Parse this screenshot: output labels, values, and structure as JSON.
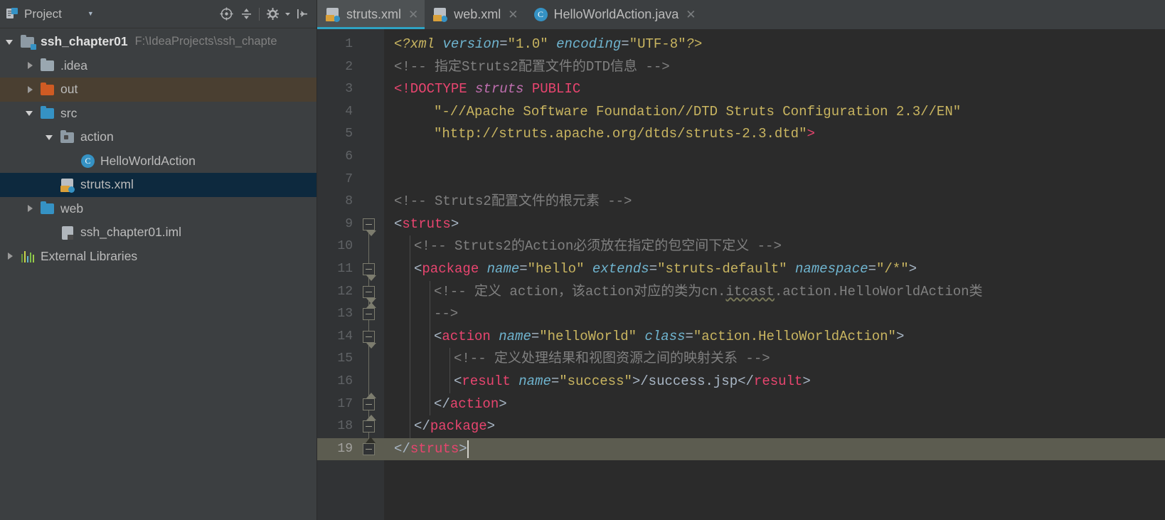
{
  "sidebar": {
    "header": {
      "title": "Project",
      "dropdown_icon": "chevron-down-icon",
      "icons": [
        "locate-icon",
        "collapse-all-icon",
        "settings-icon",
        "hide-icon"
      ]
    },
    "tree": [
      {
        "label": "ssh_chapter01",
        "path": "F:\\IdeaProjects\\ssh_chapte",
        "icon": "module-folder-icon",
        "depth": 0,
        "arrow": "down",
        "bold": true,
        "state": "normal"
      },
      {
        "label": ".idea",
        "path": "",
        "icon": "folder-gray-icon",
        "depth": 1,
        "arrow": "right",
        "bold": false,
        "state": "normal"
      },
      {
        "label": "out",
        "path": "",
        "icon": "folder-orange-icon",
        "depth": 1,
        "arrow": "right",
        "bold": false,
        "state": "brown"
      },
      {
        "label": "src",
        "path": "",
        "icon": "folder-blue-icon",
        "depth": 1,
        "arrow": "down",
        "bold": false,
        "state": "normal"
      },
      {
        "label": "action",
        "path": "",
        "icon": "package-folder-icon",
        "depth": 2,
        "arrow": "down",
        "bold": false,
        "state": "normal"
      },
      {
        "label": "HelloWorldAction",
        "path": "",
        "icon": "java-class-icon",
        "depth": 3,
        "arrow": "none",
        "bold": false,
        "state": "normal"
      },
      {
        "label": "struts.xml",
        "path": "",
        "icon": "xml-file-icon",
        "depth": 2,
        "arrow": "none",
        "bold": false,
        "state": "selected"
      },
      {
        "label": "web",
        "path": "",
        "icon": "folder-blue-icon",
        "depth": 1,
        "arrow": "right",
        "bold": false,
        "state": "normal"
      },
      {
        "label": "ssh_chapter01.iml",
        "path": "",
        "icon": "iml-file-icon",
        "depth": 2,
        "arrow": "none",
        "bold": false,
        "state": "normal"
      },
      {
        "label": "External Libraries",
        "path": "",
        "icon": "libraries-icon",
        "depth": 0,
        "arrow": "right",
        "bold": false,
        "state": "normal"
      }
    ]
  },
  "editor": {
    "tabs": [
      {
        "label": "struts.xml",
        "icon": "xml-file-icon",
        "active": true,
        "closable": true
      },
      {
        "label": "web.xml",
        "icon": "xml-file-icon",
        "active": false,
        "closable": true
      },
      {
        "label": "HelloWorldAction.java",
        "icon": "java-class-icon",
        "active": false,
        "closable": true
      }
    ],
    "current_line": 19,
    "line_numbers": [
      1,
      2,
      3,
      4,
      5,
      6,
      7,
      8,
      9,
      10,
      11,
      12,
      13,
      14,
      15,
      16,
      17,
      18,
      19
    ],
    "colors": {
      "background": "#2b2b2b",
      "gutter": "#313335",
      "current_line": "#5c5c50",
      "tag": "#e8456f",
      "attribute": "#6fb4cf",
      "value": "#c9b560",
      "comment": "#808080",
      "text": "#a9b7c6",
      "tab_underline": "#2ea3c4",
      "selection": "#0d293e"
    },
    "lines": [
      {
        "n": 1,
        "indent": 0,
        "tokens": [
          {
            "t": "proc",
            "v": "<?xml "
          },
          {
            "t": "attr",
            "v": "version"
          },
          {
            "t": "eq",
            "v": "="
          },
          {
            "t": "val",
            "v": "\"1.0\""
          },
          {
            "t": "val",
            "v": " "
          },
          {
            "t": "attr",
            "v": "encoding"
          },
          {
            "t": "eq",
            "v": "="
          },
          {
            "t": "val",
            "v": "\"UTF-8\""
          },
          {
            "t": "proc",
            "v": "?>"
          }
        ]
      },
      {
        "n": 2,
        "indent": 0,
        "tokens": [
          {
            "t": "cmt",
            "v": "<!-- 指定Struts2配置文件的DTD信息 -->"
          }
        ]
      },
      {
        "n": 3,
        "indent": 0,
        "tokens": [
          {
            "t": "doctype",
            "v": "<!DOCTYPE "
          },
          {
            "t": "dtname",
            "v": "struts"
          },
          {
            "t": "doctype",
            "v": " PUBLIC"
          }
        ]
      },
      {
        "n": 4,
        "indent": 2,
        "tokens": [
          {
            "t": "val",
            "v": "\"-//Apache Software Foundation//DTD Struts Configuration 2.3//EN\""
          }
        ]
      },
      {
        "n": 5,
        "indent": 2,
        "tokens": [
          {
            "t": "val",
            "v": "\"http://struts.apache.org/dtds/struts-2.3.dtd\""
          },
          {
            "t": "doctype",
            "v": ">"
          }
        ]
      },
      {
        "n": 6,
        "indent": 0,
        "tokens": []
      },
      {
        "n": 7,
        "indent": 0,
        "tokens": []
      },
      {
        "n": 8,
        "indent": 0,
        "tokens": [
          {
            "t": "cmt",
            "v": "<!-- Struts2配置文件的根元素 -->"
          }
        ]
      },
      {
        "n": 9,
        "indent": 0,
        "tokens": [
          {
            "t": "punct",
            "v": "<"
          },
          {
            "t": "tag",
            "v": "struts"
          },
          {
            "t": "punct",
            "v": ">"
          }
        ]
      },
      {
        "n": 10,
        "indent": 1,
        "tokens": [
          {
            "t": "cmt",
            "v": "<!-- Struts2的Action必须放在指定的包空间下定义 -->"
          }
        ]
      },
      {
        "n": 11,
        "indent": 1,
        "tokens": [
          {
            "t": "punct",
            "v": "<"
          },
          {
            "t": "tag",
            "v": "package"
          },
          {
            "t": "txt",
            "v": " "
          },
          {
            "t": "attr",
            "v": "name"
          },
          {
            "t": "eq",
            "v": "="
          },
          {
            "t": "val",
            "v": "\"hello\""
          },
          {
            "t": "txt",
            "v": " "
          },
          {
            "t": "attr",
            "v": "extends"
          },
          {
            "t": "eq",
            "v": "="
          },
          {
            "t": "val",
            "v": "\"struts-default\""
          },
          {
            "t": "txt",
            "v": " "
          },
          {
            "t": "attr",
            "v": "namespace"
          },
          {
            "t": "eq",
            "v": "="
          },
          {
            "t": "val",
            "v": "\"/*\""
          },
          {
            "t": "punct",
            "v": ">"
          }
        ]
      },
      {
        "n": 12,
        "indent": 2,
        "tokens": [
          {
            "t": "cmt",
            "v": "<!-- 定义 action，该action对应的类为cn."
          },
          {
            "t": "cmt-typo",
            "v": "itcast"
          },
          {
            "t": "cmt",
            "v": ".action.HelloWorldAction类"
          }
        ]
      },
      {
        "n": 13,
        "indent": 2,
        "tokens": [
          {
            "t": "cmt",
            "v": "-->"
          }
        ]
      },
      {
        "n": 14,
        "indent": 2,
        "tokens": [
          {
            "t": "punct",
            "v": "<"
          },
          {
            "t": "tag",
            "v": "action"
          },
          {
            "t": "txt",
            "v": " "
          },
          {
            "t": "attr",
            "v": "name"
          },
          {
            "t": "eq",
            "v": "="
          },
          {
            "t": "val",
            "v": "\"helloWorld\""
          },
          {
            "t": "txt",
            "v": " "
          },
          {
            "t": "attr",
            "v": "class"
          },
          {
            "t": "eq",
            "v": "="
          },
          {
            "t": "val",
            "v": "\"action.HelloWorldAction\""
          },
          {
            "t": "punct",
            "v": ">"
          }
        ]
      },
      {
        "n": 15,
        "indent": 3,
        "tokens": [
          {
            "t": "cmt",
            "v": "<!-- 定义处理结果和视图资源之间的映射关系 -->"
          }
        ]
      },
      {
        "n": 16,
        "indent": 3,
        "tokens": [
          {
            "t": "punct",
            "v": "<"
          },
          {
            "t": "tag",
            "v": "result"
          },
          {
            "t": "txt",
            "v": " "
          },
          {
            "t": "attr",
            "v": "name"
          },
          {
            "t": "eq",
            "v": "="
          },
          {
            "t": "val",
            "v": "\"success\""
          },
          {
            "t": "punct",
            "v": ">"
          },
          {
            "t": "txt",
            "v": "/success.jsp"
          },
          {
            "t": "punct",
            "v": "</"
          },
          {
            "t": "tag",
            "v": "result"
          },
          {
            "t": "punct",
            "v": ">"
          }
        ]
      },
      {
        "n": 17,
        "indent": 2,
        "tokens": [
          {
            "t": "punct",
            "v": "</"
          },
          {
            "t": "tag",
            "v": "action"
          },
          {
            "t": "punct",
            "v": ">"
          }
        ]
      },
      {
        "n": 18,
        "indent": 1,
        "tokens": [
          {
            "t": "punct",
            "v": "</"
          },
          {
            "t": "tag",
            "v": "package"
          },
          {
            "t": "punct",
            "v": ">"
          }
        ]
      },
      {
        "n": 19,
        "indent": 0,
        "tokens": [
          {
            "t": "punct",
            "v": "</"
          },
          {
            "t": "tag",
            "v": "struts"
          },
          {
            "t": "punct",
            "v": ">"
          }
        ]
      }
    ],
    "fold_markers": [
      {
        "line": 9,
        "type": "start"
      },
      {
        "line": 11,
        "type": "start"
      },
      {
        "line": 12,
        "type": "start"
      },
      {
        "line": 13,
        "type": "end"
      },
      {
        "line": 14,
        "type": "start"
      },
      {
        "line": 17,
        "type": "end"
      },
      {
        "line": 18,
        "type": "end"
      },
      {
        "line": 19,
        "type": "end-solid"
      }
    ]
  }
}
